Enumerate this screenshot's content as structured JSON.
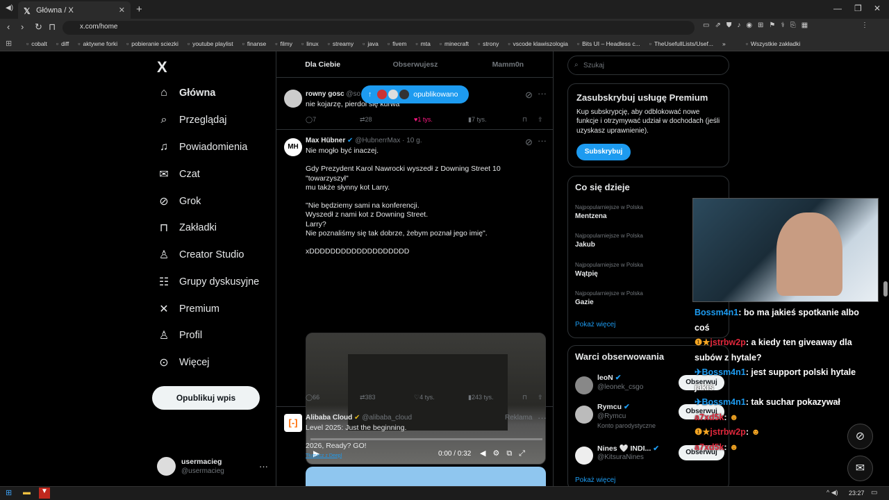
{
  "browser": {
    "tab_title": "Główna / X",
    "url": "x.com/home",
    "bookmarks": [
      "cobalt",
      "diff",
      "aktywne forki",
      "pobieranie sciezki",
      "youtube playlist",
      "finanse",
      "filmy",
      "linux",
      "streamy",
      "java",
      "fivem",
      "mta",
      "minecraft",
      "strony",
      "vscode klawiszologia",
      "Bits UI – Headless c...",
      "TheUsefullLists/Usef..."
    ],
    "bookmarks_more": "»",
    "all_bookmarks": "Wszystkie zakładki"
  },
  "nav": {
    "logo": "X",
    "items": [
      {
        "label": "Główna",
        "icon": "home-icon"
      },
      {
        "label": "Przeglądaj",
        "icon": "search-icon"
      },
      {
        "label": "Powiadomienia",
        "icon": "bell-icon"
      },
      {
        "label": "Czat",
        "icon": "mail-icon"
      },
      {
        "label": "Grok",
        "icon": "grok-icon"
      },
      {
        "label": "Zakładki",
        "icon": "bookmark-icon"
      },
      {
        "label": "Creator Studio",
        "icon": "creator-icon"
      },
      {
        "label": "Grupy dyskusyjne",
        "icon": "people-icon"
      },
      {
        "label": "Premium",
        "icon": "x-icon"
      },
      {
        "label": "Profil",
        "icon": "person-icon"
      },
      {
        "label": "Więcej",
        "icon": "more-icon"
      }
    ],
    "post_button": "Opublikuj wpis",
    "profile_name": "usermacieg",
    "profile_handle": "@usermacieg"
  },
  "feed": {
    "tabs": [
      "Dla Ciebie",
      "Obserwujesz",
      "Mamm0n"
    ],
    "published_pill": "opublikowano",
    "tweets": [
      {
        "author": "rowny gosc",
        "handle": "@so",
        "text": "nie kojarzę, pierdol się kurwa",
        "replies": "7",
        "reposts": "28",
        "likes": "1 tys.",
        "views": "7 tys."
      },
      {
        "author": "Max Hübner",
        "handle": "@HubnerrMax",
        "time": "· 10 g.",
        "avatar_text": "MH",
        "lines": [
          "Nie mogło być inaczej.",
          "",
          "Gdy Prezydent Karol Nawrocki wyszedł z Downing Street 10 \"towarzyszył\"",
          "mu także słynny kot Larry.",
          "",
          "\"Nie będziemy sami na konferencji.",
          "Wyszedł z nami kot z Downing Street.",
          "Larry?",
          "Nie poznaliśmy się tak dobrze, żebym poznał jego imię\".",
          "",
          "xDDDDDDDDDDDDDDDDDDD"
        ],
        "video_time": "0:00 / 0:32",
        "replies": "66",
        "reposts": "383",
        "likes": "4 tys.",
        "views": "243 tys."
      },
      {
        "author": "Alibaba Cloud",
        "handle": "@alibaba_cloud",
        "ad": "Reklama",
        "lines": [
          "Level 2025: Just the beginning.",
          "",
          "2026, Ready? GO!"
        ],
        "translate": "Tłumacz z Deepl"
      }
    ]
  },
  "right": {
    "search_placeholder": "Szukaj",
    "premium": {
      "title": "Zasubskrybuj usługę Premium",
      "text": "Kup subskrypcję, aby odblokować nowe funkcje i otrzymywać udział w dochodach (jeśli uzyskasz uprawnienie).",
      "button": "Subskrybuj"
    },
    "trends": {
      "title": "Co się dzieje",
      "items": [
        {
          "category": "Najpopularniejsze w Polska",
          "name": "Mentzena"
        },
        {
          "category": "Najpopularniejsze w Polska",
          "name": "Jakub"
        },
        {
          "category": "Najpopularniejsze w Polska",
          "name": "Wątpię"
        },
        {
          "category": "Najpopularniejsze w Polska",
          "name": "Gazie"
        }
      ],
      "more": "Pokaż więcej"
    },
    "who_to_follow": {
      "title": "Warci obserwowania",
      "items": [
        {
          "name": "leoN",
          "handle": "@leonek_csgo",
          "extra": ""
        },
        {
          "name": "Rymcu",
          "handle": "@Rymcu",
          "extra": "Konto parodystyczne"
        },
        {
          "name": "Nines 🤍 INDI...",
          "handle": "@KitsuraNines",
          "extra": ""
        }
      ],
      "button": "Obserwuj",
      "more": "Pokaż więcej"
    }
  },
  "chat": [
    {
      "user": "Bossm4n1",
      "msg": ": bo ma jakieś spotkanie albo coś",
      "color": "cn"
    },
    {
      "user": "jstrbw2p",
      "msg": ": a kiedy ten giveaway dla subów z hytale?",
      "color": "cr"
    },
    {
      "user": "Bossm4n1",
      "msg": ": jest support polski hytale jakiś",
      "color": "cn"
    },
    {
      "user": "Bossm4n1",
      "msg": ": tak suchar pokazywał",
      "color": "cn"
    },
    {
      "user": "a7xd5k",
      "msg": ":",
      "color": "cr"
    },
    {
      "user": "jstrbw2p",
      "msg": ":",
      "color": "cr"
    },
    {
      "user": "a7xd5k",
      "msg": ":",
      "color": "cr"
    }
  ],
  "taskbar": {
    "time": "23:27"
  }
}
